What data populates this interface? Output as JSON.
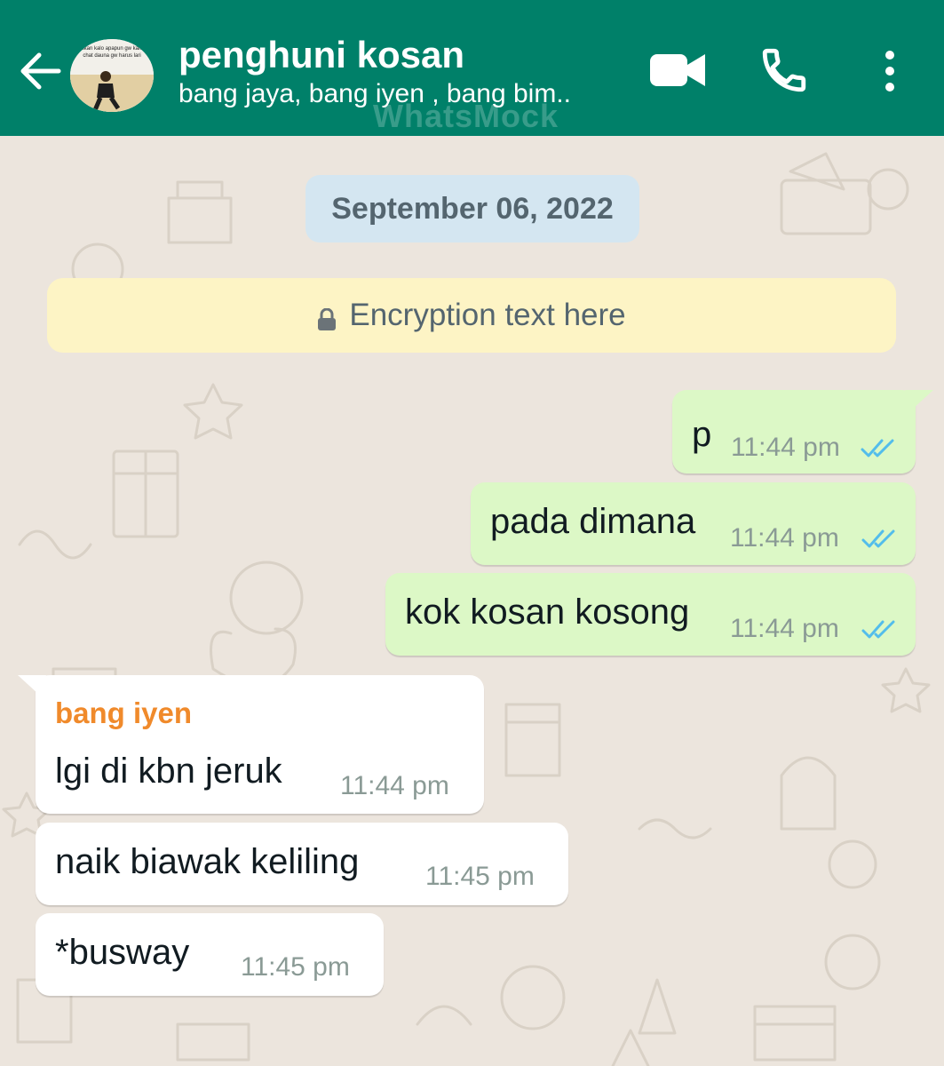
{
  "header": {
    "title": "penghuni kosan",
    "subtitle": "bang jaya, bang iyen , bang bim..",
    "watermark": "WhatsMock",
    "avatar_caption_line1": "akan kalo apapun gw kalo",
    "avatar_caption_line2": "chat dauna gw harus lari"
  },
  "date_chip": "September 06, 2022",
  "encryption_text": "Encryption text here",
  "messages": [
    {
      "direction": "outgoing",
      "text": "p",
      "time": "11:44 pm",
      "status": "read"
    },
    {
      "direction": "outgoing",
      "text": "pada dimana",
      "time": "11:44 pm",
      "status": "read"
    },
    {
      "direction": "outgoing",
      "text": "kok kosan kosong",
      "time": "11:44 pm",
      "status": "read"
    },
    {
      "direction": "incoming",
      "sender": "bang iyen",
      "text": "lgi di kbn jeruk",
      "time": "11:44 pm"
    },
    {
      "direction": "incoming",
      "text": "naik biawak keliling",
      "time": "11:45 pm"
    },
    {
      "direction": "incoming",
      "text": "*busway",
      "time": "11:45 pm"
    }
  ],
  "colors": {
    "header": "#008069",
    "chat_background": "#ECE5DD",
    "outgoing_bubble": "#DCF8C6",
    "incoming_bubble": "#FFFFFF",
    "date_chip": "#D4E6F1",
    "encryption_banner": "#FDF4C5",
    "sender_name": "#F08A2B",
    "read_ticks": "#53BDEB"
  },
  "icons": {
    "back": "arrow-left-icon",
    "video": "video-camera-icon",
    "call": "phone-icon",
    "menu": "more-vert-icon",
    "lock": "lock-icon",
    "ticks": "double-check-icon"
  }
}
